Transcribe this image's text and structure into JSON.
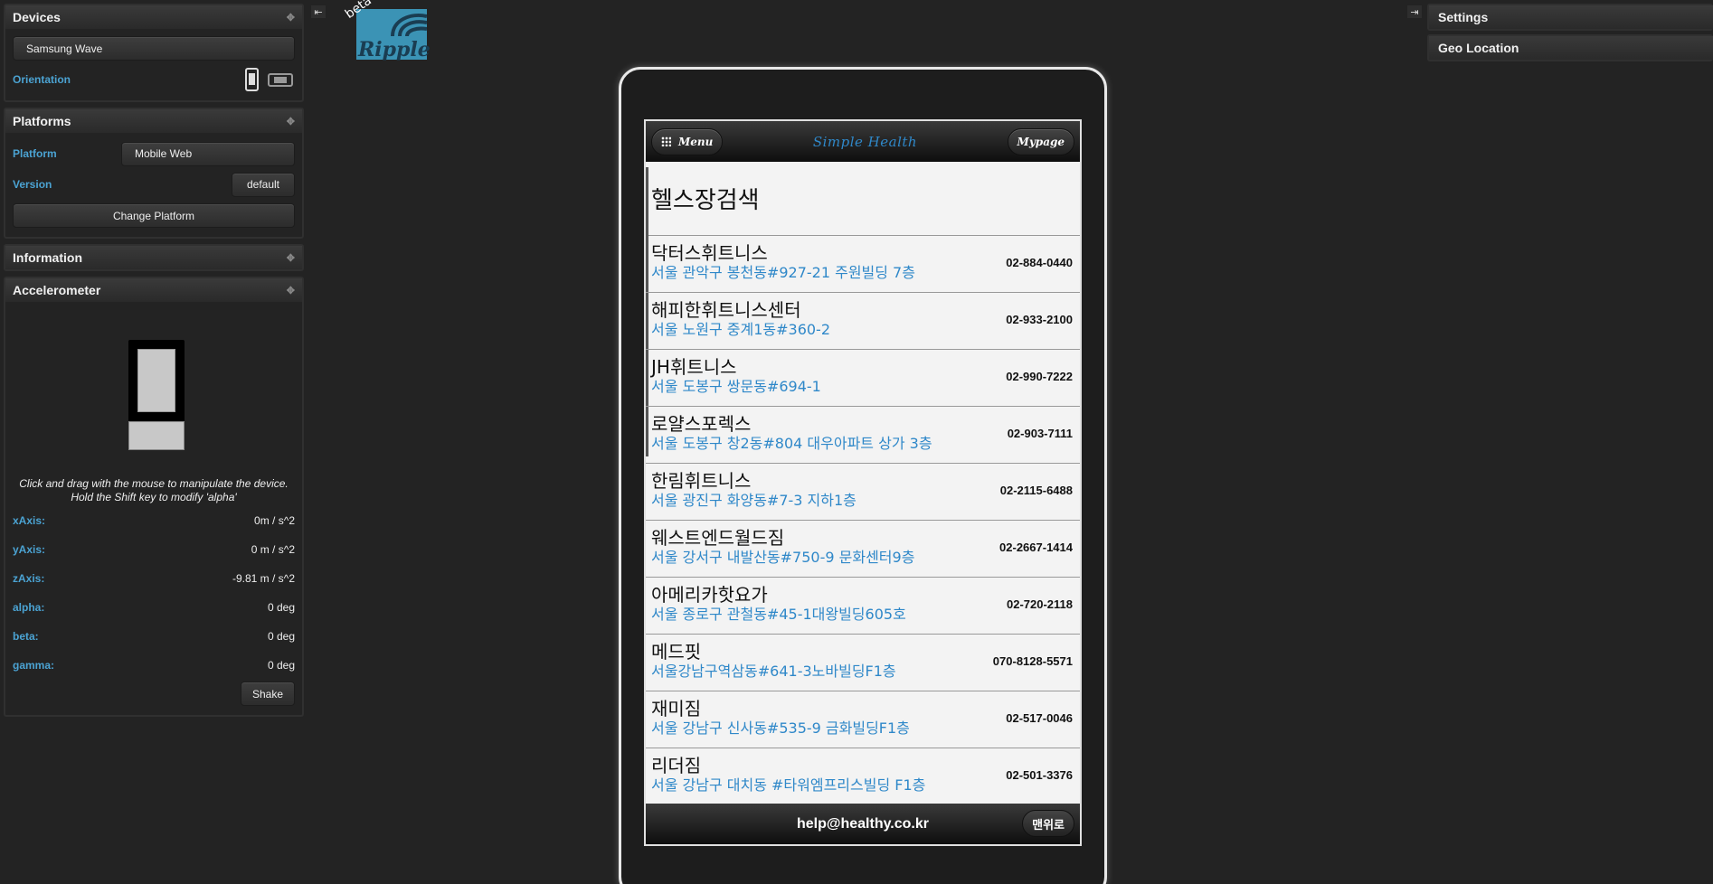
{
  "left": {
    "devices": {
      "title": "Devices",
      "device_name": "Samsung Wave",
      "orientation_label": "Orientation",
      "orientation_icons": [
        "portrait-icon",
        "landscape-icon"
      ]
    },
    "platforms": {
      "title": "Platforms",
      "platform_label": "Platform",
      "platform_value": "Mobile Web",
      "version_label": "Version",
      "version_value": "default",
      "change_button": "Change Platform"
    },
    "information": {
      "title": "Information"
    },
    "accelerometer": {
      "title": "Accelerometer",
      "hint": "Click and drag with the mouse to manipulate the device. Hold the Shift key to modify 'alpha'",
      "rows": [
        {
          "label": "xAxis:",
          "value": "0m / s^2"
        },
        {
          "label": "yAxis:",
          "value": "0 m / s^2"
        },
        {
          "label": "zAxis:",
          "value": "-9.81 m / s^2"
        },
        {
          "label": "alpha:",
          "value": "0 deg"
        },
        {
          "label": "beta:",
          "value": "0 deg"
        },
        {
          "label": "gamma:",
          "value": "0 deg"
        }
      ],
      "shake_button": "Shake"
    }
  },
  "logo": {
    "beta": "beta",
    "name": "Ripple"
  },
  "right": {
    "settings_title": "Settings",
    "geo_title": "Geo Location"
  },
  "app": {
    "menu_label": "Menu",
    "title": "Simple Health",
    "mypage_label": "Mypage",
    "page_title": "헬스장검색",
    "gyms": [
      {
        "name": "닥터스휘트니스",
        "address": "서울 관악구 봉천동#927-21 주원빌딩 7층",
        "phone": "02-884-0440"
      },
      {
        "name": "해피한휘트니스센터",
        "address": "서울 노원구 중계1동#360-2",
        "phone": "02-933-2100"
      },
      {
        "name": "JH휘트니스",
        "address": "서울 도봉구 쌍문동#694-1",
        "phone": "02-990-7222"
      },
      {
        "name": "로얄스포렉스",
        "address": "서울 도봉구 창2동#804 대우아파트 상가 3층",
        "phone": "02-903-7111"
      },
      {
        "name": "한림휘트니스",
        "address": "서울 광진구 화양동#7-3 지하1층",
        "phone": "02-2115-6488"
      },
      {
        "name": "웨스트엔드월드짐",
        "address": "서울 강서구 내발산동#750-9 문화센터9층",
        "phone": "02-2667-1414"
      },
      {
        "name": "아메리카핫요가",
        "address": "서울 종로구 관철동#45-1대왕빌딩605호",
        "phone": "02-720-2118"
      },
      {
        "name": "메드핏",
        "address": "서울강남구역삼동#641-3노바빌딩F1층",
        "phone": "070-8128-5571"
      },
      {
        "name": "재미짐",
        "address": "서울 강남구 신사동#535-9 금화빌딩F1층",
        "phone": "02-517-0046"
      },
      {
        "name": "리더짐",
        "address": "서울 강남구 대치동 #타워엠프리스빌딩 F1층",
        "phone": "02-501-3376"
      }
    ],
    "footer_email": "help@healthy.co.kr",
    "top_button": "맨위로"
  }
}
